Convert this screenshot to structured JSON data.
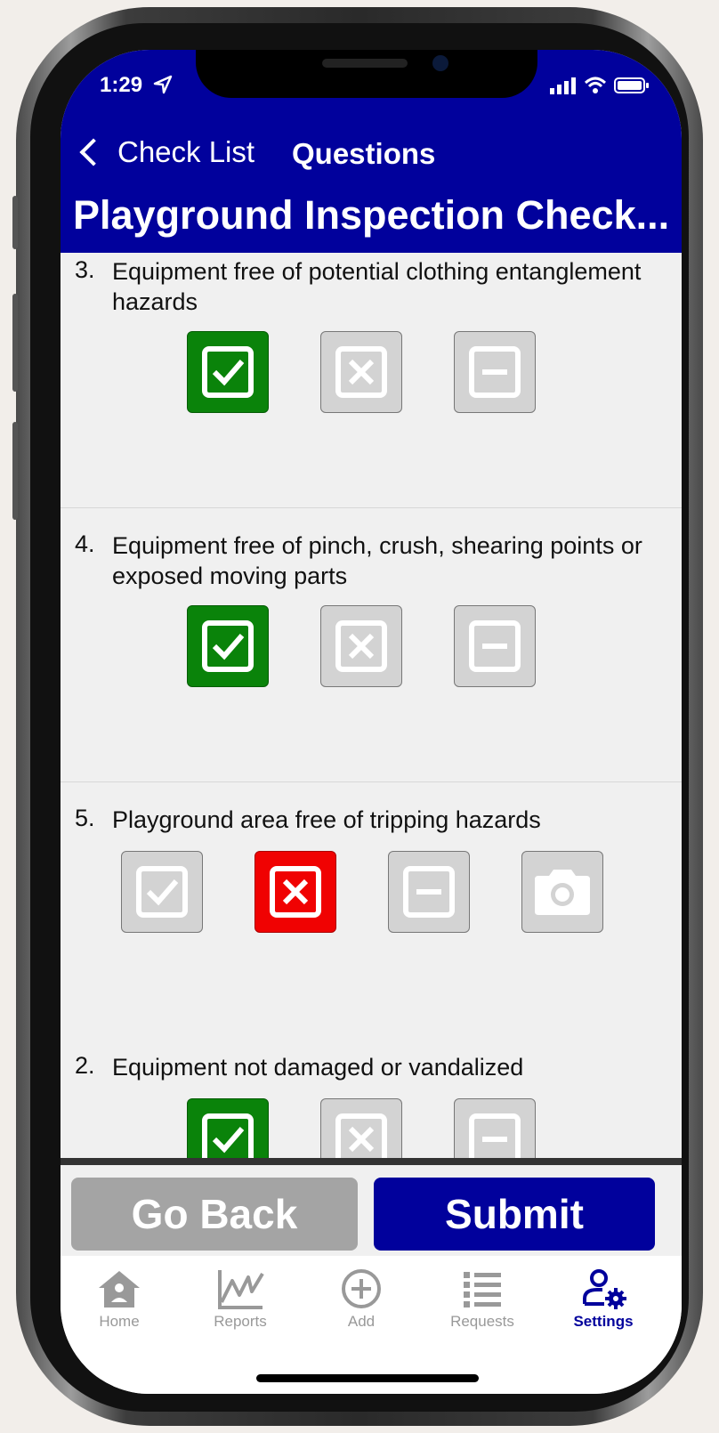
{
  "status_bar": {
    "time": "1:29"
  },
  "nav": {
    "back_label": "Check List",
    "title": "Questions"
  },
  "page_title": "Playground Inspection Check...",
  "questions": [
    {
      "number": "3.",
      "text": "Equipment free of potential clothing entanglement hazards",
      "answer": "pass"
    },
    {
      "number": "4.",
      "text": "Equipment free of pinch, crush, shearing points or exposed moving parts",
      "answer": "pass"
    },
    {
      "number": "5.",
      "text": "Playground area free of tripping hazards",
      "answer": "fail",
      "has_photo_option": true
    },
    {
      "number": "2.",
      "text": "Equipment not damaged or vandalized",
      "answer": "pass"
    }
  ],
  "buttons": {
    "go_back": "Go Back",
    "submit": "Submit"
  },
  "tabs": [
    {
      "label": "Home",
      "icon": "home-icon"
    },
    {
      "label": "Reports",
      "icon": "reports-chart-icon"
    },
    {
      "label": "Add",
      "icon": "add-circle-icon"
    },
    {
      "label": "Requests",
      "icon": "list-icon"
    },
    {
      "label": "Settings",
      "icon": "user-settings-icon",
      "active": true
    }
  ],
  "colors": {
    "brand_blue": "#01019c",
    "pass_green": "#0a830a",
    "fail_red": "#f00202",
    "inactive_gray": "#d3d3d3"
  }
}
